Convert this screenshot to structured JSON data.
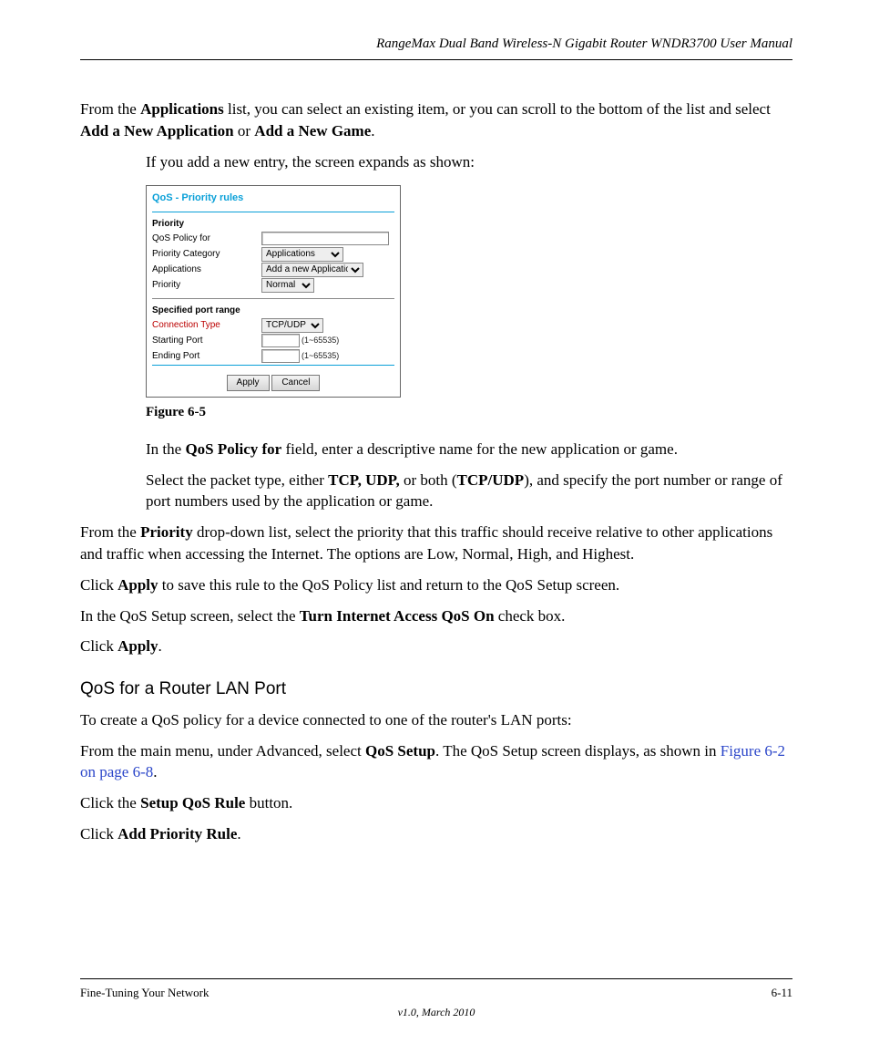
{
  "header": {
    "manual_title": "RangeMax Dual Band Wireless-N Gigabit Router WNDR3700 User Manual"
  },
  "p1": {
    "t1": "From the ",
    "bold1": "Applications",
    "t2": " list, you can select an existing item, or you can scroll to the bottom of the list and select ",
    "bold2": "Add a New Application",
    "t3": " or ",
    "bold3": "Add a New Game",
    "t4": "."
  },
  "p2": {
    "text": "If you add a new entry, the screen expands as shown:"
  },
  "qos": {
    "title": "QoS - Priority rules",
    "priority_section": "Priority",
    "policy_for_label": "QoS Policy for",
    "policy_for_value": "",
    "category_label": "Priority Category",
    "category_value": "Applications",
    "apps_label": "Applications",
    "apps_value": "Add a new Application",
    "priority_label": "Priority",
    "priority_value": "Normal",
    "port_section": "Specified port range",
    "conn_label": "Connection Type",
    "conn_value": "TCP/UDP",
    "start_label": "Starting Port",
    "start_value": "",
    "start_hint": "(1~65535)",
    "end_label": "Ending Port",
    "end_value": "",
    "end_hint": "(1~65535)",
    "apply": "Apply",
    "cancel": "Cancel"
  },
  "fig_caption": "Figure 6-5",
  "p3": {
    "t1": "In the ",
    "bold1": "QoS Policy for",
    "t2": " field, enter a descriptive name for the new application or game."
  },
  "p4": {
    "t1": "Select the packet type, either ",
    "bold1": "TCP, UDP,",
    "t2": " or both (",
    "bold2": "TCP/UDP",
    "t3": "), and specify the port number or range of port numbers used by the application or game."
  },
  "p5": {
    "t1": "From the ",
    "bold1": "Priority",
    "t2": " drop-down list, select the priority that this traffic should receive relative to other applications and traffic when accessing the Internet. The options are Low, Normal, High, and Highest."
  },
  "p6": {
    "t1": "Click ",
    "bold1": "Apply",
    "t2": " to save this rule to the QoS Policy list and return to the QoS Setup screen."
  },
  "p7": {
    "t1": "In the QoS Setup screen, select the ",
    "bold1": "Turn Internet Access QoS On",
    "t2": " check box."
  },
  "p8": {
    "t1": "Click ",
    "bold1": "Apply",
    "t2": "."
  },
  "heading": "QoS for a Router LAN Port",
  "p9": {
    "text": "To create a QoS policy for a device connected to one of the router's LAN ports:"
  },
  "p10": {
    "t1": "From the main menu, under Advanced, select ",
    "bold1": "QoS Setup",
    "t2": ". The QoS Setup screen displays, as shown in ",
    "link": "Figure 6-2 on page 6-8",
    "t3": "."
  },
  "p11": {
    "t1": "Click the ",
    "bold1": "Setup QoS Rule ",
    "t2": "button."
  },
  "p12": {
    "t1": "Click ",
    "bold1": "Add Priority Rule",
    "t2": "."
  },
  "footer": {
    "left": "Fine-Tuning Your Network",
    "right": "6-11",
    "version": "v1.0, March 2010"
  }
}
